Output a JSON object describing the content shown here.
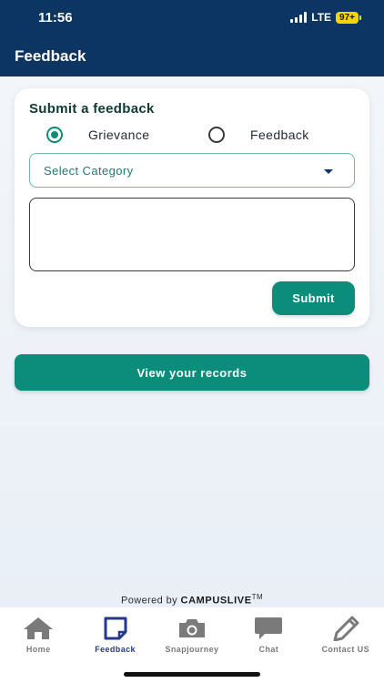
{
  "status_bar": {
    "time": "11:56",
    "network": "LTE",
    "battery": "97+"
  },
  "header": {
    "title": "Feedback"
  },
  "form": {
    "title": "Submit a feedback",
    "options": [
      {
        "label": "Grievance",
        "selected": true
      },
      {
        "label": "Feedback",
        "selected": false
      }
    ],
    "category_placeholder": "Select Category",
    "message_value": "",
    "submit_label": "Submit"
  },
  "records_label": "View your records",
  "footer": {
    "powered_prefix": "Powered by",
    "brand": "CAMPUSLIVE",
    "trademark": "TM"
  },
  "nav": {
    "items": [
      {
        "label": "Home",
        "icon": "home-icon"
      },
      {
        "label": "Feedback",
        "icon": "feedback-icon",
        "active": true
      },
      {
        "label": "Snapjourney",
        "icon": "camera-icon"
      },
      {
        "label": "Chat",
        "icon": "chat-icon"
      },
      {
        "label": "Contact US",
        "icon": "pencil-icon"
      }
    ]
  },
  "colors": {
    "header": "#0d3563",
    "accent": "#0c8c7a",
    "nav_active": "#233a8a",
    "nav_inactive": "#7a7a7a"
  }
}
